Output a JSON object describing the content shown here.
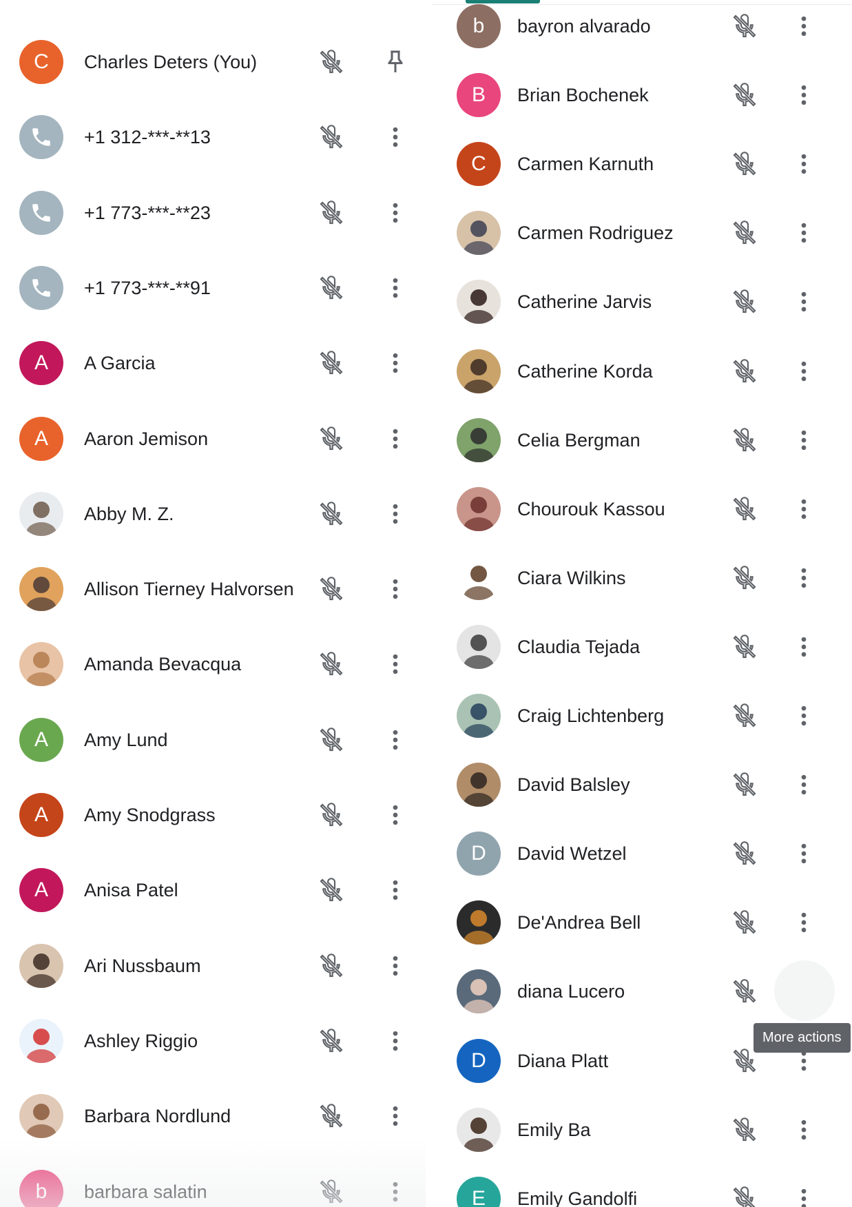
{
  "colors": {
    "orange": "#e8632b",
    "pink": "#e8467c",
    "magenta": "#c2185b",
    "rust": "#c5451a",
    "green": "#6aa84f",
    "brown": "#8d6e63",
    "slate": "#90a4ae",
    "blue": "#1565c0",
    "teal": "#26a69a",
    "icon_gray": "#5f6368",
    "tooltip_bg": "#5f6368",
    "accent": "#1a7f74"
  },
  "tooltip": {
    "text": "More actions"
  },
  "left_column": [
    {
      "name": "Charles Deters (You)",
      "avatar": {
        "type": "letter",
        "letter": "C",
        "color": "#e8632b"
      },
      "action_icon": "pin-icon"
    },
    {
      "name": "+1 312-***-**13",
      "avatar": {
        "type": "phone",
        "color": "#a4b5bf"
      },
      "action_icon": "more-vert-icon"
    },
    {
      "name": "+1 773-***-**23",
      "avatar": {
        "type": "phone",
        "color": "#a4b5bf"
      },
      "action_icon": "more-vert-icon"
    },
    {
      "name": "+1 773-***-**91",
      "avatar": {
        "type": "phone",
        "color": "#a4b5bf"
      },
      "action_icon": "more-vert-icon"
    },
    {
      "name": "A Garcia",
      "avatar": {
        "type": "letter",
        "letter": "A",
        "color": "#c2185b"
      },
      "action_icon": "more-vert-icon"
    },
    {
      "name": "Aaron Jemison",
      "avatar": {
        "type": "letter",
        "letter": "A",
        "color": "#e8632b"
      },
      "action_icon": "more-vert-icon"
    },
    {
      "name": "Abby M. Z.",
      "avatar": {
        "type": "photo",
        "bg": "#e9ecef",
        "fg": "#6d5b4a"
      },
      "action_icon": "more-vert-icon"
    },
    {
      "name": "Allison Tierney Halvorsen",
      "avatar": {
        "type": "photo",
        "bg": "#e0a25c",
        "fg": "#4a3b36"
      },
      "action_icon": "more-vert-icon"
    },
    {
      "name": "Amanda Bevacqua",
      "avatar": {
        "type": "photo",
        "bg": "#e8c3a5",
        "fg": "#b37b4c"
      },
      "action_icon": "more-vert-icon"
    },
    {
      "name": "Amy Lund",
      "avatar": {
        "type": "letter",
        "letter": "A",
        "color": "#6aa84f"
      },
      "action_icon": "more-vert-icon"
    },
    {
      "name": "Amy Snodgrass",
      "avatar": {
        "type": "letter",
        "letter": "A",
        "color": "#c5451a"
      },
      "action_icon": "more-vert-icon"
    },
    {
      "name": "Anisa Patel",
      "avatar": {
        "type": "letter",
        "letter": "A",
        "color": "#c2185b"
      },
      "action_icon": "more-vert-icon"
    },
    {
      "name": "Ari Nussbaum",
      "avatar": {
        "type": "photo",
        "bg": "#d9c4b0",
        "fg": "#3b2b22"
      },
      "action_icon": "more-vert-icon"
    },
    {
      "name": "Ashley Riggio",
      "avatar": {
        "type": "photo",
        "bg": "#eaf3fb",
        "fg": "#d32f2f"
      },
      "action_icon": "more-vert-icon"
    },
    {
      "name": "Barbara Nordlund",
      "avatar": {
        "type": "photo",
        "bg": "#e0c9b6",
        "fg": "#8a5a3c"
      },
      "action_icon": "more-vert-icon"
    },
    {
      "name": "barbara salatin",
      "avatar": {
        "type": "letter",
        "letter": "b",
        "color": "#e8467c"
      },
      "action_icon": "more-vert-icon"
    }
  ],
  "right_column": [
    {
      "name": "bayron alvarado",
      "avatar": {
        "type": "letter",
        "letter": "b",
        "color": "#8d6e63"
      },
      "action_icon": "more-vert-icon"
    },
    {
      "name": "Brian Bochenek",
      "avatar": {
        "type": "letter",
        "letter": "B",
        "color": "#e8467c"
      },
      "action_icon": "more-vert-icon"
    },
    {
      "name": "Carmen Karnuth",
      "avatar": {
        "type": "letter",
        "letter": "C",
        "color": "#c5451a"
      },
      "action_icon": "more-vert-icon"
    },
    {
      "name": "Carmen Rodriguez",
      "avatar": {
        "type": "photo",
        "bg": "#d7c2a8",
        "fg": "#3c3f52"
      },
      "action_icon": "more-vert-icon"
    },
    {
      "name": "Catherine Jarvis",
      "avatar": {
        "type": "photo",
        "bg": "#e8e2dc",
        "fg": "#2b1a17"
      },
      "action_icon": "more-vert-icon"
    },
    {
      "name": "Catherine Korda",
      "avatar": {
        "type": "photo",
        "bg": "#c9a36a",
        "fg": "#3a2a22"
      },
      "action_icon": "more-vert-icon"
    },
    {
      "name": "Celia Bergman",
      "avatar": {
        "type": "photo",
        "bg": "#7fa36b",
        "fg": "#2b2b2b"
      },
      "action_icon": "more-vert-icon"
    },
    {
      "name": "Chourouk Kassou",
      "avatar": {
        "type": "photo",
        "bg": "#c9958a",
        "fg": "#6b2f2a"
      },
      "action_icon": "more-vert-icon"
    },
    {
      "name": "Ciara Wilkins",
      "avatar": {
        "type": "photo",
        "bg": "#ffffff",
        "fg": "#5b3a22"
      },
      "action_icon": "more-vert-icon"
    },
    {
      "name": "Claudia Tejada",
      "avatar": {
        "type": "photo",
        "bg": "#e4e4e4",
        "fg": "#3a3a3a"
      },
      "action_icon": "more-vert-icon"
    },
    {
      "name": "Craig Lichtenberg",
      "avatar": {
        "type": "photo",
        "bg": "#a9c2b3",
        "fg": "#25405a"
      },
      "action_icon": "more-vert-icon"
    },
    {
      "name": "David Balsley",
      "avatar": {
        "type": "photo",
        "bg": "#b08c68",
        "fg": "#2e2520"
      },
      "action_icon": "more-vert-icon"
    },
    {
      "name": "David Wetzel",
      "avatar": {
        "type": "letter",
        "letter": "D",
        "color": "#90a4ae"
      },
      "action_icon": "more-vert-icon"
    },
    {
      "name": "De'Andrea Bell",
      "avatar": {
        "type": "photo",
        "bg": "#2b2b2b",
        "fg": "#d98a2b"
      },
      "action_icon": "more-vert-icon"
    },
    {
      "name": "diana Lucero",
      "avatar": {
        "type": "photo",
        "bg": "#5a6a7a",
        "fg": "#f0d0c0"
      },
      "action_icon": "more-vert-icon"
    },
    {
      "name": "Diana Platt",
      "avatar": {
        "type": "letter",
        "letter": "D",
        "color": "#1565c0"
      },
      "action_icon": "more-vert-icon"
    },
    {
      "name": "Emily Ba",
      "avatar": {
        "type": "photo",
        "bg": "#e8e8e8",
        "fg": "#3b2418"
      },
      "action_icon": "more-vert-icon"
    },
    {
      "name": "Emily Gandolfi",
      "avatar": {
        "type": "letter",
        "letter": "E",
        "color": "#26a69a"
      },
      "action_icon": "more-vert-icon"
    }
  ]
}
